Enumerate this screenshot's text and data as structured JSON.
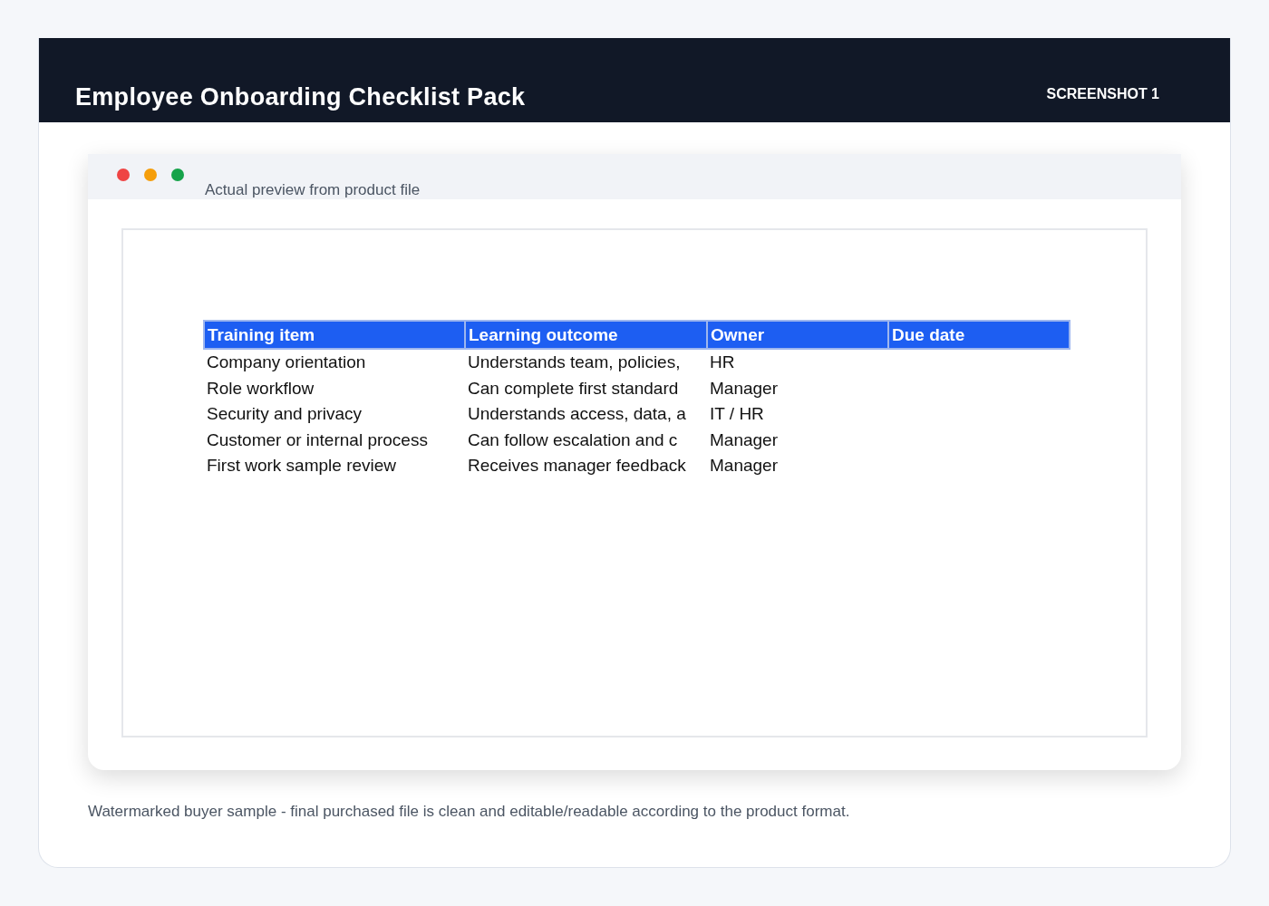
{
  "header": {
    "title": "Employee Onboarding Checklist Pack",
    "badge": "SCREENSHOT 1"
  },
  "preview": {
    "caption": "Actual preview from product file",
    "table": {
      "columns": [
        "Training item",
        "Learning outcome",
        "Owner",
        "Due date"
      ],
      "rows": [
        [
          "Company orientation",
          "Understands team, policies,",
          "HR"
        ],
        [
          "Role workflow",
          "Can complete first standard",
          "Manager"
        ],
        [
          "Security and privacy",
          "Understands access, data, a",
          "IT / HR"
        ],
        [
          "Customer or internal process",
          "Can follow escalation and c",
          "Manager"
        ],
        [
          "First work sample review",
          "Receives manager feedback",
          "Manager"
        ]
      ]
    }
  },
  "footnote": "Watermarked buyer sample - final purchased file is clean and editable/readable according to the product format."
}
